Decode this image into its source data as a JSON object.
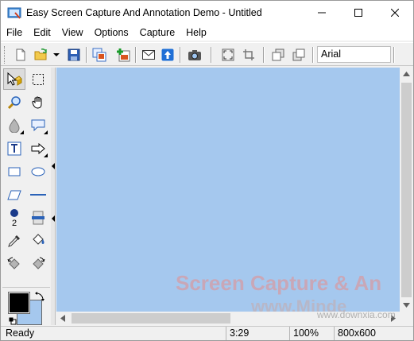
{
  "window": {
    "title": "Easy Screen Capture And Annotation Demo - Untitled",
    "controls": [
      "minimize",
      "maximize",
      "close"
    ]
  },
  "menu": {
    "items": [
      "File",
      "Edit",
      "View",
      "Options",
      "Capture",
      "Help"
    ]
  },
  "toolbar": {
    "buttons": [
      "new-icon",
      "open-icon",
      "dropdown-arrow-icon",
      "save-icon",
      "copy-image-icon",
      "add-image-icon",
      "mail-icon",
      "upload-icon",
      "camera-icon",
      "full-screen-icon",
      "crop-icon",
      "send-backward-icon",
      "bring-forward-icon"
    ],
    "font_name": "Arial"
  },
  "toolbox": {
    "tools": [
      "select-arrow-icon",
      "rect-select-icon",
      "zoom-icon",
      "pan-hand-icon",
      "fill-drop-icon",
      "callout-icon",
      "text-box-icon",
      "arrow-shape-icon",
      "rectangle-icon",
      "ellipse-icon",
      "polygon-icon",
      "line-icon",
      "step-marker-icon",
      "highlight-icon",
      "color-picker-icon",
      "paint-bucket-icon",
      "rotate-left-icon",
      "rotate-right-icon"
    ],
    "active_tool": "select-arrow-icon",
    "step_number": "2",
    "foreground_color": "#000000",
    "background_color": "#a5c8ee"
  },
  "canvas": {
    "background": "#a5c8ee",
    "watermark_line1": "Screen Capture & An",
    "watermark_line2": "www.Minde",
    "watermark_url": "www.downxia.com"
  },
  "status": {
    "message": "Ready",
    "position": "3:29",
    "zoom": "100%",
    "size": "800x600"
  }
}
